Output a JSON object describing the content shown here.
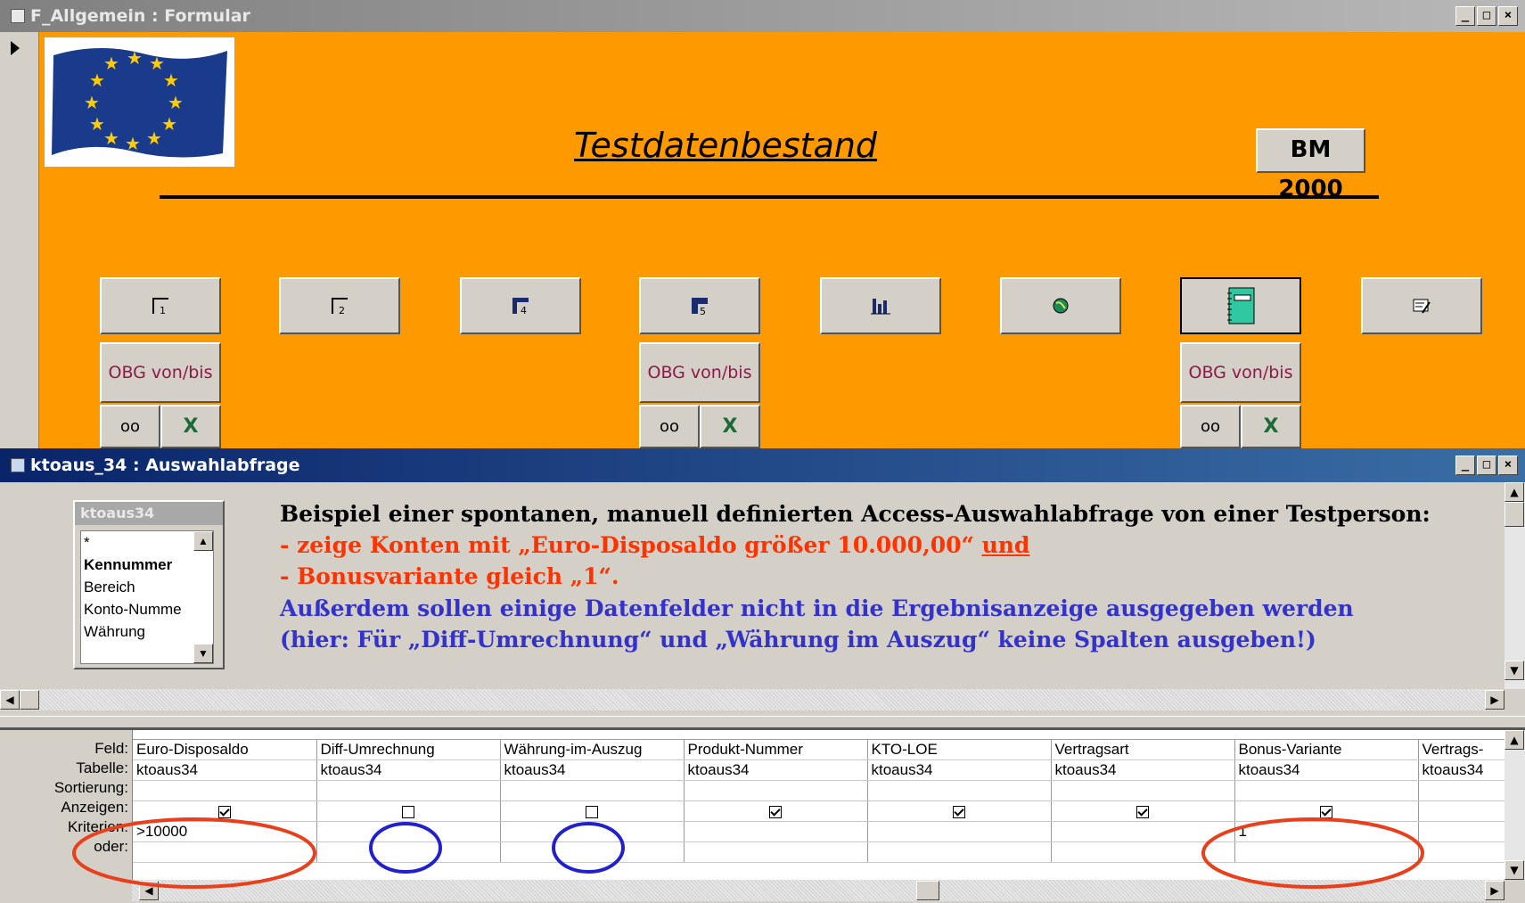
{
  "form_window": {
    "title": "F_Allgemein : Formular",
    "heading": "Testdatenbestand",
    "logo_text": "BM 2000",
    "toolbar_buttons": [
      {
        "icon": "page-1-icon",
        "glyph": "1"
      },
      {
        "icon": "page-2-icon",
        "glyph": "2"
      },
      {
        "icon": "page-4-icon",
        "glyph": "4"
      },
      {
        "icon": "page-5-icon",
        "glyph": "5"
      },
      {
        "icon": "bar-chart-icon"
      },
      {
        "icon": "globe-icon"
      },
      {
        "icon": "notebook-icon"
      },
      {
        "icon": "edit-form-icon"
      }
    ],
    "obg_label": "OBG von/bis",
    "colors": {
      "background": "#ff9900",
      "obg_text": "#8b1a4a"
    }
  },
  "query_window": {
    "title": "ktoaus_34 : Auswahlabfrage",
    "table_box": {
      "name": "ktoaus34",
      "fields": [
        "*",
        "Kennummer",
        "Bereich",
        "Konto-Numme",
        "Währung"
      ]
    },
    "annotation": {
      "line1": "Beispiel einer spontanen, manuell definierten Access-Auswahlabfrage von einer Testperson:",
      "line2_prefix": "- zeige Konten mit „Euro-Disposaldo größer 10.000,00“ ",
      "line2_link": "und",
      "line3": "- Bonusvariante gleich „1“.",
      "line4": "Außerdem sollen einige Datenfelder nicht in die Ergebnisanzeige ausgegeben  werden",
      "line5": "(hier: Für  „Diff-Umrechnung“ und „Währung im Auszug“ keine Spalten ausgeben!)"
    },
    "grid": {
      "row_labels": [
        "Feld:",
        "Tabelle:",
        "Sortierung:",
        "Anzeigen:",
        "Kriterien:",
        "oder:"
      ],
      "columns": [
        {
          "feld": "Euro-Disposaldo",
          "tabelle": "ktoaus34",
          "sortierung": "",
          "anzeigen": true,
          "kriterien": ">10000"
        },
        {
          "feld": "Diff-Umrechnung",
          "tabelle": "ktoaus34",
          "sortierung": "",
          "anzeigen": false,
          "kriterien": ""
        },
        {
          "feld": "Währung-im-Auszug",
          "tabelle": "ktoaus34",
          "sortierung": "",
          "anzeigen": false,
          "kriterien": ""
        },
        {
          "feld": "Produkt-Nummer",
          "tabelle": "ktoaus34",
          "sortierung": "",
          "anzeigen": true,
          "kriterien": ""
        },
        {
          "feld": "KTO-LOE",
          "tabelle": "ktoaus34",
          "sortierung": "",
          "anzeigen": true,
          "kriterien": ""
        },
        {
          "feld": "Vertragsart",
          "tabelle": "ktoaus34",
          "sortierung": "",
          "anzeigen": true,
          "kriterien": ""
        },
        {
          "feld": "Bonus-Variante",
          "tabelle": "ktoaus34",
          "sortierung": "",
          "anzeigen": true,
          "kriterien": "1"
        },
        {
          "feld": "Vertrags-",
          "tabelle": "ktoaus34",
          "sortierung": "",
          "anzeigen": null,
          "kriterien": ""
        }
      ]
    },
    "colors": {
      "red": "#ff3300",
      "blue": "#3333cc",
      "highlight_red": "#e8401c",
      "highlight_blue": "#2020cc"
    }
  }
}
